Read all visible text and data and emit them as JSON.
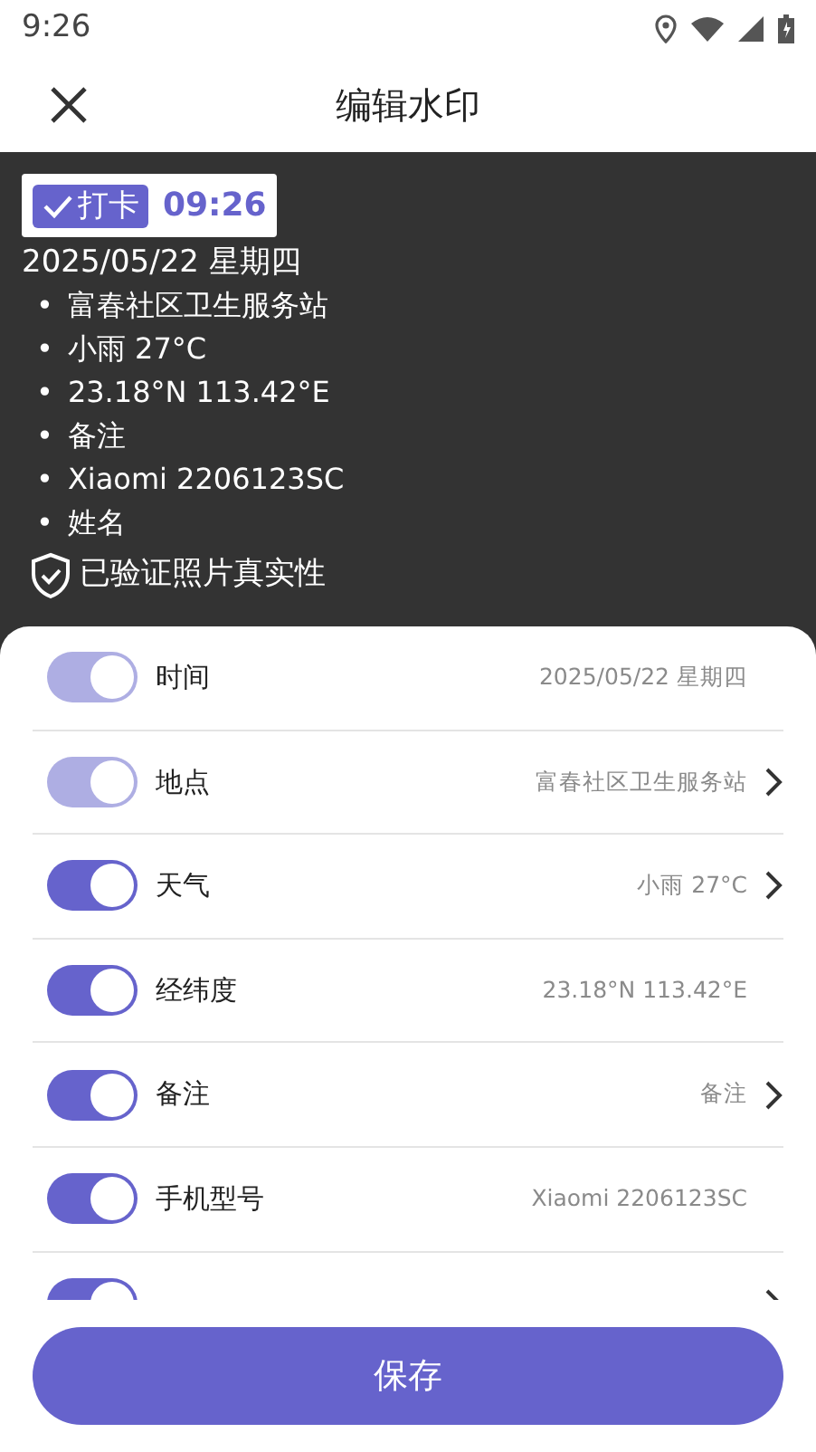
{
  "status_bar": {
    "time": "9:26"
  },
  "header": {
    "title": "编辑水印"
  },
  "preview": {
    "badge": "打卡",
    "time": "09:26",
    "date": "2025/05/22 星期四",
    "bullets": [
      {
        "mark": "•",
        "text": "富春社区卫生服务站"
      },
      {
        "mark": "•",
        "text": "小雨 27°C"
      },
      {
        "mark": "•",
        "text": "23.18°N 113.42°E"
      },
      {
        "mark": "•",
        "text": "备注"
      },
      {
        "mark": "•",
        "text": "Xiaomi 2206123SC"
      },
      {
        "mark": "•",
        "text": "姓名"
      }
    ],
    "verified": "已验证照片真实性"
  },
  "settings": [
    {
      "label": "时间",
      "value": "2025/05/22 星期四",
      "on": true,
      "disabled": true,
      "arrow": false
    },
    {
      "label": "地点",
      "value": "富春社区卫生服务站",
      "on": true,
      "disabled": true,
      "arrow": true
    },
    {
      "label": "天气",
      "value": "小雨 27°C",
      "on": true,
      "disabled": false,
      "arrow": true
    },
    {
      "label": "经纬度",
      "value": "23.18°N 113.42°E",
      "on": true,
      "disabled": false,
      "arrow": false
    },
    {
      "label": "备注",
      "value": "备注",
      "on": true,
      "disabled": false,
      "arrow": true
    },
    {
      "label": "手机型号",
      "value": "Xiaomi 2206123SC",
      "on": true,
      "disabled": false,
      "arrow": false
    },
    {
      "on": true,
      "disabled": false,
      "arrow": true
    }
  ],
  "save_button": "保存"
}
